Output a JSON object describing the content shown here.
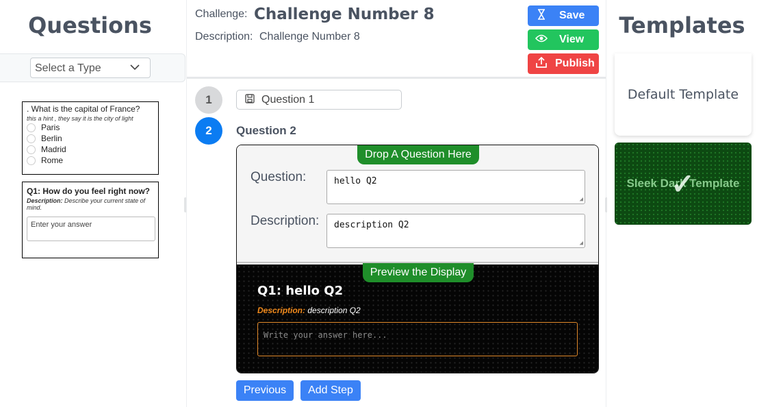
{
  "left": {
    "title": "Questions",
    "type_select": {
      "value": "Select a Type"
    },
    "card1": {
      "question": ". What is the capital of France?",
      "hint": "this a hint , they say it is the city of light",
      "options": [
        "Paris",
        "Berlin",
        "Madrid",
        "Rome"
      ]
    },
    "card2": {
      "label": "Q1:",
      "question": "How do you feel right now?",
      "desc_label": "Description:",
      "desc": "Describe your current state of mind.",
      "placeholder": "Enter your answer"
    }
  },
  "header": {
    "challenge_label": "Challenge:",
    "challenge_name": "Challenge Number 8",
    "description_label": "Description:",
    "description_value": "Challenge Number 8",
    "save_label": "Save",
    "view_label": "View",
    "publish_label": "Publish",
    "colors": {
      "save": "#3b82f6",
      "view": "#22c55e",
      "publish": "#ef4444"
    }
  },
  "steps": {
    "step1_number": "1",
    "step1_label": "Question 1",
    "step2_number": "2",
    "step2_title": "Question 2"
  },
  "editor": {
    "drop_tab": "Drop A Question Here",
    "question_label": "Question:",
    "question_value": "hello Q2",
    "description_label": "Description:",
    "description_value": "description Q2",
    "preview_tab": "Preview the Display",
    "preview_title": "Q1: hello Q2",
    "preview_desc_label": "Description:",
    "preview_desc_value": "description Q2",
    "preview_placeholder": "Write your answer here..."
  },
  "footer": {
    "previous_label": "Previous",
    "add_step_label": "Add Step"
  },
  "right": {
    "title": "Templates",
    "templates": [
      "Default Template",
      "Sleek Dark Template"
    ]
  }
}
